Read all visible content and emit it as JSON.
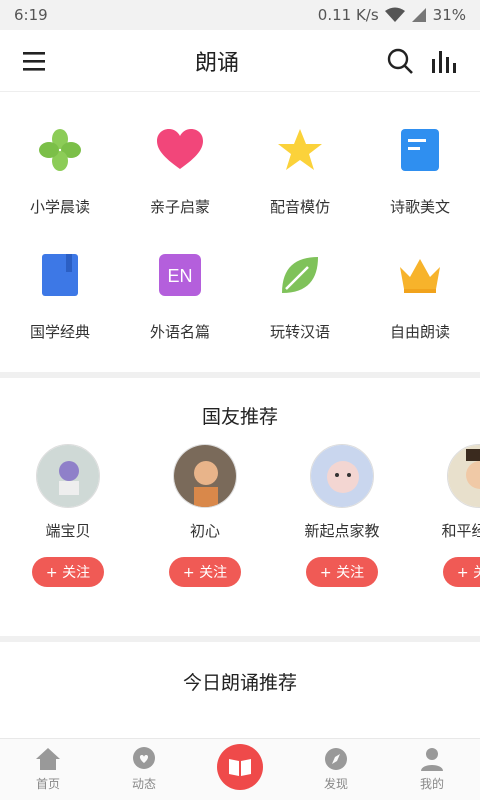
{
  "status_bar": {
    "time": "6:19",
    "speed": "0.11 K/s",
    "battery": "31%"
  },
  "app_bar": {
    "title": "朗诵",
    "menu_icon": "menu-icon",
    "search_icon": "search-icon",
    "stats_icon": "bar-chart-icon"
  },
  "categories": [
    {
      "label": "小学晨读",
      "icon": "clover-icon"
    },
    {
      "label": "亲子启蒙",
      "icon": "heart-icon"
    },
    {
      "label": "配音模仿",
      "icon": "star-icon"
    },
    {
      "label": "诗歌美文",
      "icon": "notebook-icon"
    },
    {
      "label": "国学经典",
      "icon": "book-icon"
    },
    {
      "label": "外语名篇",
      "icon": "en-badge-icon",
      "icon_text": "EN"
    },
    {
      "label": "玩转汉语",
      "icon": "leaf-icon"
    },
    {
      "label": "自由朗读",
      "icon": "crown-icon"
    }
  ],
  "friends_section": {
    "title": "国友推荐",
    "follow_label": "+ 关注",
    "friends": [
      {
        "name": "端宝贝"
      },
      {
        "name": "初心"
      },
      {
        "name": "新起点家教"
      },
      {
        "name": "和平经贸院"
      }
    ]
  },
  "today_section": {
    "title": "今日朗诵推荐"
  },
  "tab_bar": {
    "tabs": [
      {
        "label": "首页",
        "icon": "home-icon"
      },
      {
        "label": "动态",
        "icon": "chat-heart-icon"
      },
      {
        "label": "",
        "icon": "open-book-icon"
      },
      {
        "label": "发现",
        "icon": "compass-icon"
      },
      {
        "label": "我的",
        "icon": "user-icon"
      }
    ]
  },
  "colors": {
    "accent": "#f05a55",
    "tab_center": "#ef4a4a"
  }
}
